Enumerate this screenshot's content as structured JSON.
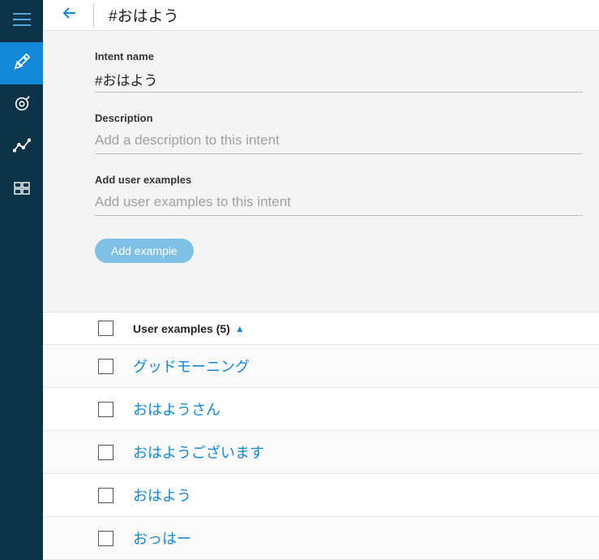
{
  "sidebar": {
    "items": [
      {
        "name": "hamburger-icon"
      },
      {
        "name": "tools-icon"
      },
      {
        "name": "target-icon"
      },
      {
        "name": "analytics-icon"
      },
      {
        "name": "grid-icon"
      }
    ]
  },
  "header": {
    "title": "#おはよう"
  },
  "form": {
    "intent_name": {
      "label": "Intent name",
      "value": "#おはよう"
    },
    "description": {
      "label": "Description",
      "placeholder": "Add a description to this intent"
    },
    "add_examples": {
      "label": "Add user examples",
      "placeholder": "Add user examples to this intent"
    },
    "add_button": "Add example"
  },
  "examples": {
    "header_label": "User examples (5)",
    "sort_arrow": "▲",
    "items": [
      {
        "text": "グッドモーニング"
      },
      {
        "text": "おはようさん"
      },
      {
        "text": "おはようございます"
      },
      {
        "text": "おはよう"
      },
      {
        "text": "おっはー"
      }
    ]
  }
}
